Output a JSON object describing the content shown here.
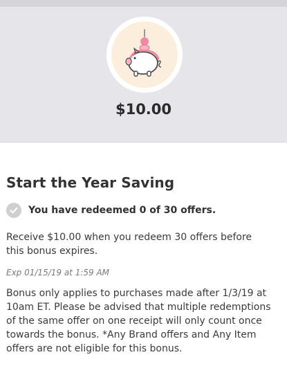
{
  "reward": {
    "amount": "$10.00",
    "icon": "piggy-bank-icon"
  },
  "offer": {
    "title": "Start the Year Saving",
    "status_text": "You have redeemed 0 of 30 offers.",
    "status_icon": "checkmark-circle-icon",
    "redeemed": 0,
    "total": 30,
    "description": "Receive $10.00 when you redeem 30 offers before this bonus expires.",
    "expiration": "Exp 01/15/19 at 1:59 AM",
    "terms": "Bonus only applies to purchases made after 1/3/19 at 10am ET. Please be advised that multiple redemptions of the same offer on one receipt will only count once towards the bonus. *Any Brand offers and Any Item offers are not eligible for this bonus."
  },
  "colors": {
    "header_bg": "#e6e5ea",
    "badge_bg": "#fbeedc",
    "pig_accent": "#f08aa2"
  }
}
